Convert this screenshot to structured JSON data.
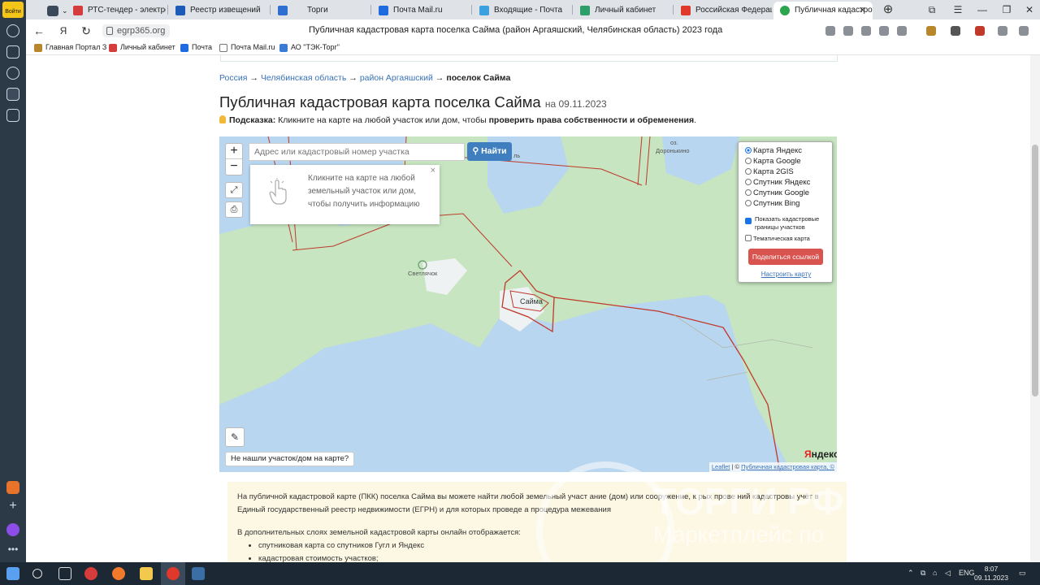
{
  "browser": {
    "login_label": "Войти",
    "tabs": [
      {
        "title": "РТС-тендер - электрон",
        "color": "#d53c3c"
      },
      {
        "title": "Реестр извещений",
        "color": "#1d5bb8"
      },
      {
        "title": "Торги",
        "color": "#2f6fd1"
      },
      {
        "title": "Почта Mail.ru",
        "color": "#1f6ae0"
      },
      {
        "title": "Входящие - Почта",
        "color": "#3aa0e0"
      },
      {
        "title": "Личный кабинет",
        "color": "#2e9f6a"
      },
      {
        "title": "Российская Федерация",
        "color": "#e0392b"
      },
      {
        "title": "Публичная кадастро",
        "color": "#2da44e"
      }
    ],
    "url": "egrp365.org",
    "page_title": "Публичная кадастровая карта поселка Сайма (район Аргаяшский, Челябинская область) 2023 года",
    "bookmarks": [
      {
        "label": "Главная Портал З",
        "color": "#b8862b"
      },
      {
        "label": "Личный кабинет",
        "color": "#d53c3c"
      },
      {
        "label": "Почта",
        "color": "#1f6ae0"
      },
      {
        "label": "Почта Mail.ru",
        "color": "#777777"
      },
      {
        "label": "АО \"ТЭК-Торг\"",
        "color": "#3a7bd5"
      }
    ]
  },
  "page": {
    "breadcrumbs": [
      "Россия",
      "Челябинская область",
      "район Аргаяшский",
      "поселок Сайма"
    ],
    "title": "Публичная кадастровая карта поселка Сайма",
    "date": "на 09.11.2023",
    "hint_label": "Подсказка:",
    "hint_text": "Кликните на карте на любой участок или дом, чтобы",
    "hint_bold": "проверить права собственности и обременения",
    "hint_end": "."
  },
  "map": {
    "zoom_in": "+",
    "zoom_out": "−",
    "search_placeholder": "Адрес или кадастровый номер участка",
    "find_button": "Найти",
    "popup_text": "Кликните на карте на любой земельный участок или дом, чтобы получить информацию",
    "popup_close": "×",
    "layers": [
      {
        "label": "Карта Яндекс",
        "selected": true
      },
      {
        "label": "Карта Google",
        "selected": false
      },
      {
        "label": "Карта 2GIS",
        "selected": false
      },
      {
        "label": "Спутник Яндекс",
        "selected": false
      },
      {
        "label": "Спутник Google",
        "selected": false
      },
      {
        "label": "Спутник Bing",
        "selected": false
      }
    ],
    "show_borders_label": "Показать кадастровые границы участков",
    "show_borders_checked": true,
    "thematic_label": "Тематическая карта",
    "thematic_checked": false,
    "share_button": "Поделиться ссылкой",
    "configure_link": "Настроить карту",
    "not_found_button": "Не нашли участок/дом на карте?",
    "place_saima": "Сайма",
    "place_svetlyachok": "Светлячок",
    "place_lake": "оз.",
    "place_doroninkino": "Доронькино",
    "place_partial": "ль",
    "yandex_logo_y": "Я",
    "yandex_logo_rest": "ндекс",
    "attribution_leaflet": "Leaflet",
    "attribution_sep": " | © ",
    "attribution_pkk": "Публичная кадастровая карта, ©",
    "colors": {
      "water": "#b8d6ef",
      "land": "#c6e5c0",
      "border": "#c0392b"
    }
  },
  "info": {
    "p1": "На публичной кадастровой карте (ПКК) поселка Сайма вы можете найти любой земельный участ    ание (дом) или сооружение, к     рых прове    ний кадастровы     учёт в Единый государственный реестр недвижимости (ЕГРН) и для которых проведе    а процедура межевания",
    "p2": "В дополнительных слоях земельной кадастровой карты онлайн отображается:",
    "items": [
      "спутниковая карта со спутников Гугл и Яндекс",
      "кадастровая стоимость участков;"
    ]
  },
  "watermark": {
    "title": "ТОРГИ РФ",
    "subtitle": "Маркетплейс по"
  },
  "taskbar": {
    "lang": "ENG",
    "time": "8:07",
    "date": "09.11.2023"
  }
}
